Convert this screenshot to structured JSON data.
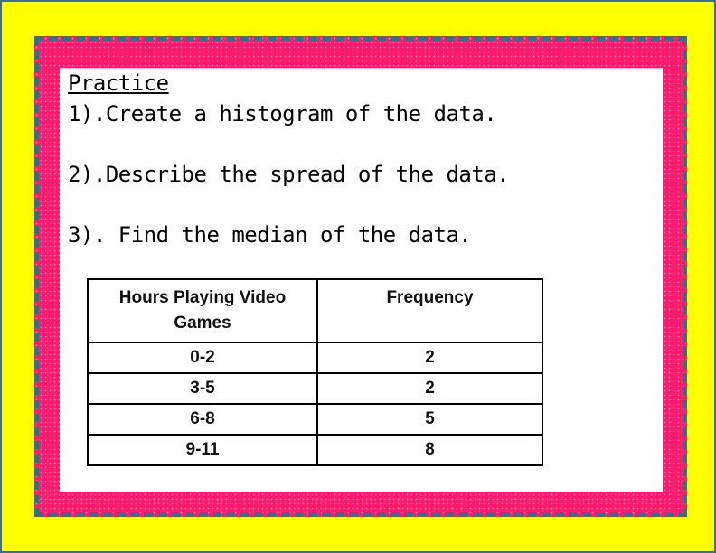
{
  "heading": "Practice",
  "questions": [
    "1).Create a histogram of the data.",
    "2).Describe the spread of the data.",
    "3). Find the median of the data."
  ],
  "table": {
    "headers": [
      "Hours Playing Video Games",
      "Frequency"
    ],
    "rows": [
      [
        "0-2",
        "2"
      ],
      [
        "3-5",
        "2"
      ],
      [
        "6-8",
        "5"
      ],
      [
        "9-11",
        "8"
      ]
    ]
  },
  "colors": {
    "background": "#ffff00",
    "panel": "#ff1a6e",
    "border": "#3e6a8a"
  }
}
